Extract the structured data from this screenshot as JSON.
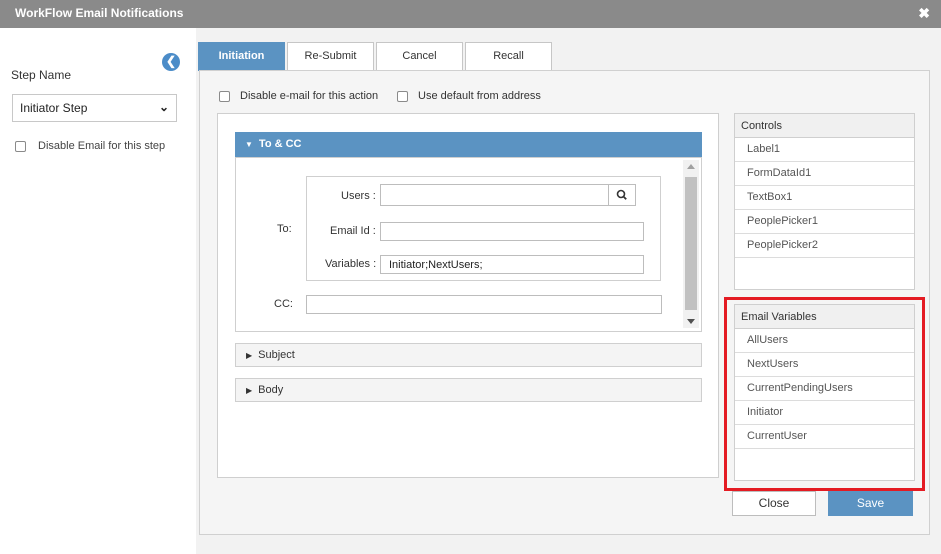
{
  "window": {
    "title": "WorkFlow Email Notifications",
    "close_glyph": "✖"
  },
  "left": {
    "collapse_glyph": "❮",
    "step_name_label": "Step Name",
    "step_value": "Initiator Step",
    "disable_step_label": "Disable Email for this step"
  },
  "tabs": [
    {
      "label": "Initiation",
      "active": true
    },
    {
      "label": "Re-Submit",
      "active": false
    },
    {
      "label": "Cancel",
      "active": false
    },
    {
      "label": "Recall",
      "active": false
    }
  ],
  "options": {
    "disable_action_label": "Disable e-mail for this action",
    "default_from_label": "Use default from address"
  },
  "to_cc": {
    "header": "To & CC",
    "to_label": "To:",
    "users_label": "Users :",
    "users_value": "",
    "email_id_label": "Email Id :",
    "email_id_value": "",
    "variables_label": "Variables :",
    "variables_value": "Initiator;NextUsers;",
    "cc_label": "CC:",
    "cc_value": ""
  },
  "sections": {
    "subject": "Subject",
    "body": "Body"
  },
  "controls": {
    "header": "Controls",
    "items": [
      "Label1",
      "FormDataId1",
      "TextBox1",
      "PeoplePicker1",
      "PeoplePicker2"
    ]
  },
  "email_variables": {
    "header": "Email Variables",
    "items": [
      "AllUsers",
      "NextUsers",
      "CurrentPendingUsers",
      "Initiator",
      "CurrentUser"
    ]
  },
  "buttons": {
    "close": "Close",
    "save": "Save"
  },
  "colors": {
    "accent": "#5b93c2",
    "highlight": "#e41b23",
    "titlebar": "#8a8a8a"
  },
  "icons": {
    "search": "search-icon",
    "collapse": "chevron-left-circle-icon",
    "close": "close-icon"
  }
}
